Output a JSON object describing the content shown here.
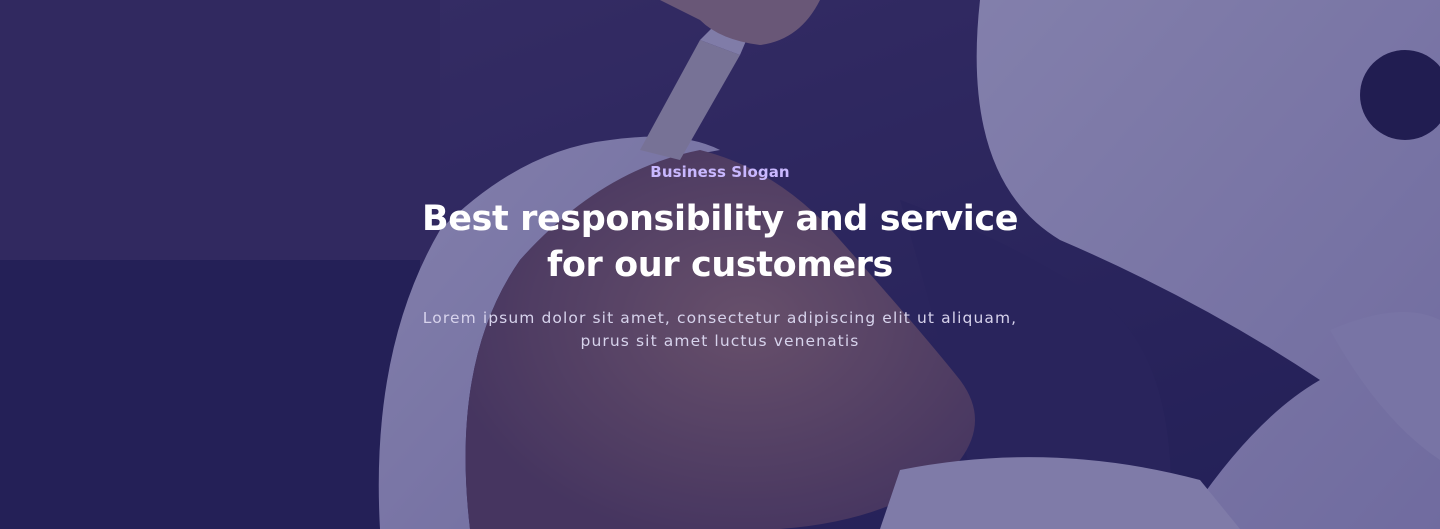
{
  "hero": {
    "slogan": "Business Slogan",
    "headline_line1": "Best responsibility and service",
    "headline_line2": "for our customers",
    "subtext_line1": "Lorem ipsum dolor sit amet, consectetur adipiscing elit ut aliquam,",
    "subtext_line2": "purus sit amet luctus venenatis",
    "overlay_color": "#28246e",
    "slogan_color": "#c9b8ff"
  }
}
